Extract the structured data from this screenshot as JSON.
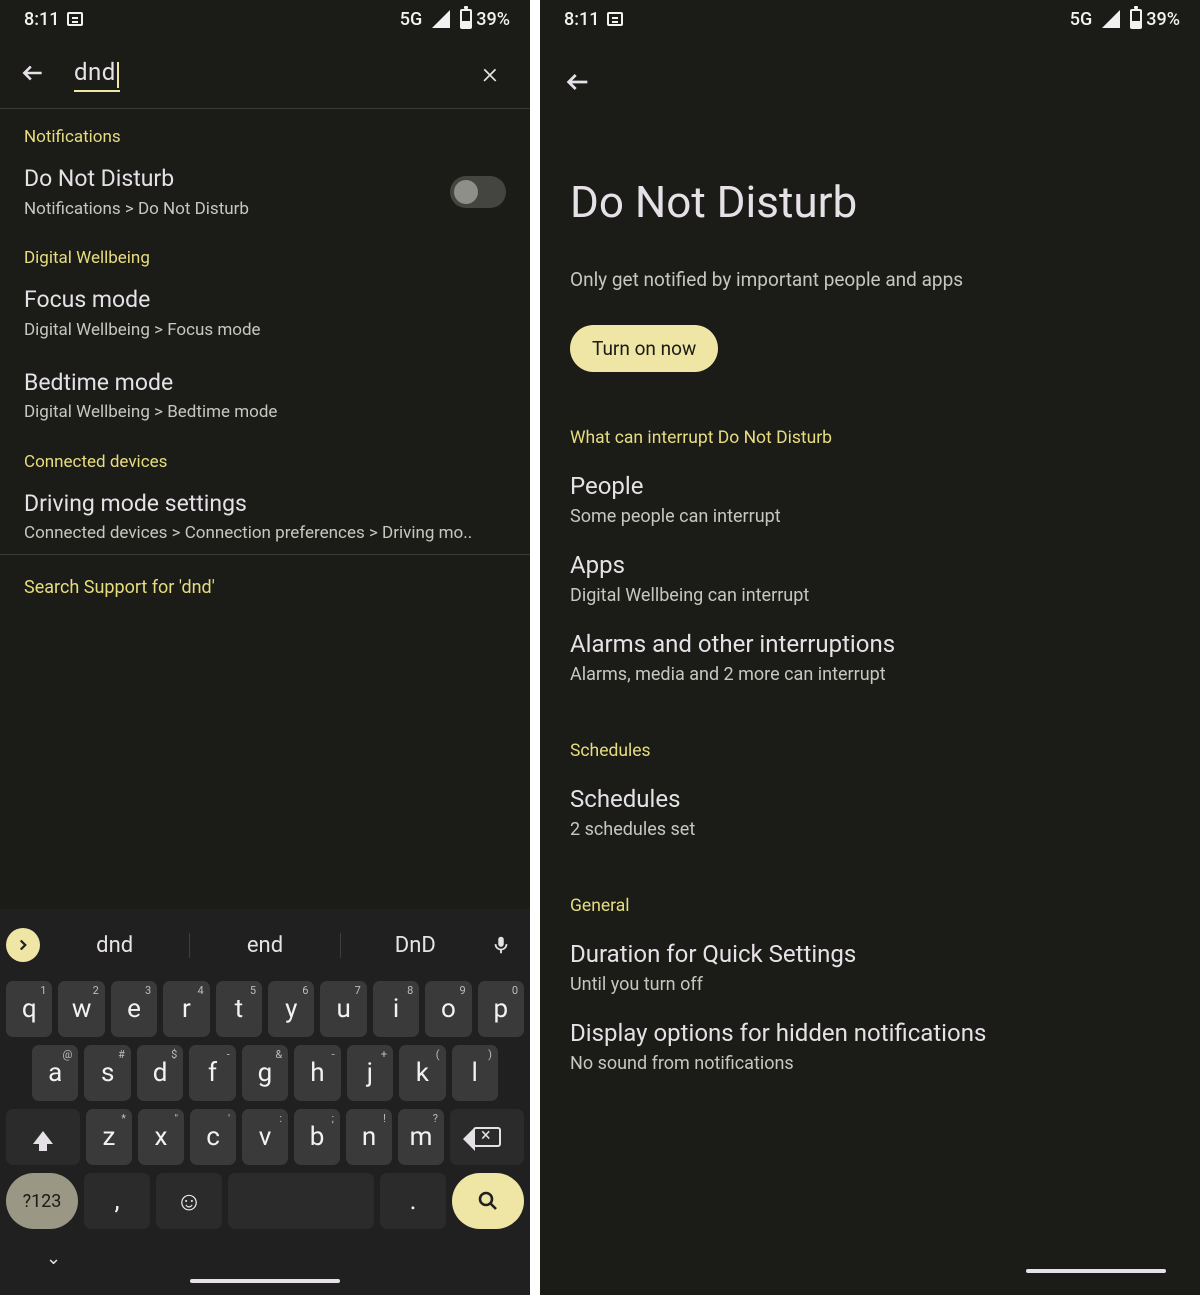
{
  "status": {
    "time": "8:11",
    "network": "5G",
    "battery": "39%"
  },
  "left": {
    "search_value": "dnd",
    "sections": {
      "notifications": {
        "header": "Notifications",
        "dnd": {
          "title": "Do Not Disturb",
          "path": "Notifications > Do Not Disturb"
        }
      },
      "wellbeing": {
        "header": "Digital Wellbeing",
        "focus": {
          "title": "Focus mode",
          "path": "Digital Wellbeing > Focus mode"
        },
        "bedtime": {
          "title": "Bedtime mode",
          "path": "Digital Wellbeing > Bedtime mode"
        }
      },
      "connected": {
        "header": "Connected devices",
        "driving": {
          "title": "Driving mode settings",
          "path": "Connected devices > Connection preferences > Driving mo.."
        }
      }
    },
    "support": "Search Support for 'dnd'",
    "suggestions": [
      "dnd",
      "end",
      "DnD"
    ],
    "keyboard": {
      "row1": [
        {
          "k": "q",
          "h": "1"
        },
        {
          "k": "w",
          "h": "2"
        },
        {
          "k": "e",
          "h": "3"
        },
        {
          "k": "r",
          "h": "4"
        },
        {
          "k": "t",
          "h": "5"
        },
        {
          "k": "y",
          "h": "6"
        },
        {
          "k": "u",
          "h": "7"
        },
        {
          "k": "i",
          "h": "8"
        },
        {
          "k": "o",
          "h": "9"
        },
        {
          "k": "p",
          "h": "0"
        }
      ],
      "row2": [
        {
          "k": "a",
          "h": "@"
        },
        {
          "k": "s",
          "h": "#"
        },
        {
          "k": "d",
          "h": "$"
        },
        {
          "k": "f",
          "h": "-"
        },
        {
          "k": "g",
          "h": "&"
        },
        {
          "k": "h",
          "h": "-"
        },
        {
          "k": "j",
          "h": "+"
        },
        {
          "k": "k",
          "h": "("
        },
        {
          "k": "l",
          "h": ")"
        }
      ],
      "row3": [
        {
          "k": "z",
          "h": "*"
        },
        {
          "k": "x",
          "h": "\""
        },
        {
          "k": "c",
          "h": "'"
        },
        {
          "k": "v",
          "h": ":"
        },
        {
          "k": "b",
          "h": ";"
        },
        {
          "k": "n",
          "h": "!"
        },
        {
          "k": "m",
          "h": "?"
        }
      ],
      "symkey": "?123",
      "comma": ",",
      "period": "."
    }
  },
  "right": {
    "title": "Do Not Disturb",
    "subtitle": "Only get notified by important people and apps",
    "button": "Turn on now",
    "interrupt_header": "What can interrupt Do Not Disturb",
    "people": {
      "title": "People",
      "sub": "Some people can interrupt"
    },
    "apps": {
      "title": "Apps",
      "sub": "Digital Wellbeing can interrupt"
    },
    "alarms": {
      "title": "Alarms and other interruptions",
      "sub": "Alarms, media and 2 more can interrupt"
    },
    "schedules_header": "Schedules",
    "schedules": {
      "title": "Schedules",
      "sub": "2 schedules set"
    },
    "general_header": "General",
    "duration": {
      "title": "Duration for Quick Settings",
      "sub": "Until you turn off"
    },
    "hidden": {
      "title": "Display options for hidden notifications",
      "sub": "No sound from notifications"
    }
  }
}
